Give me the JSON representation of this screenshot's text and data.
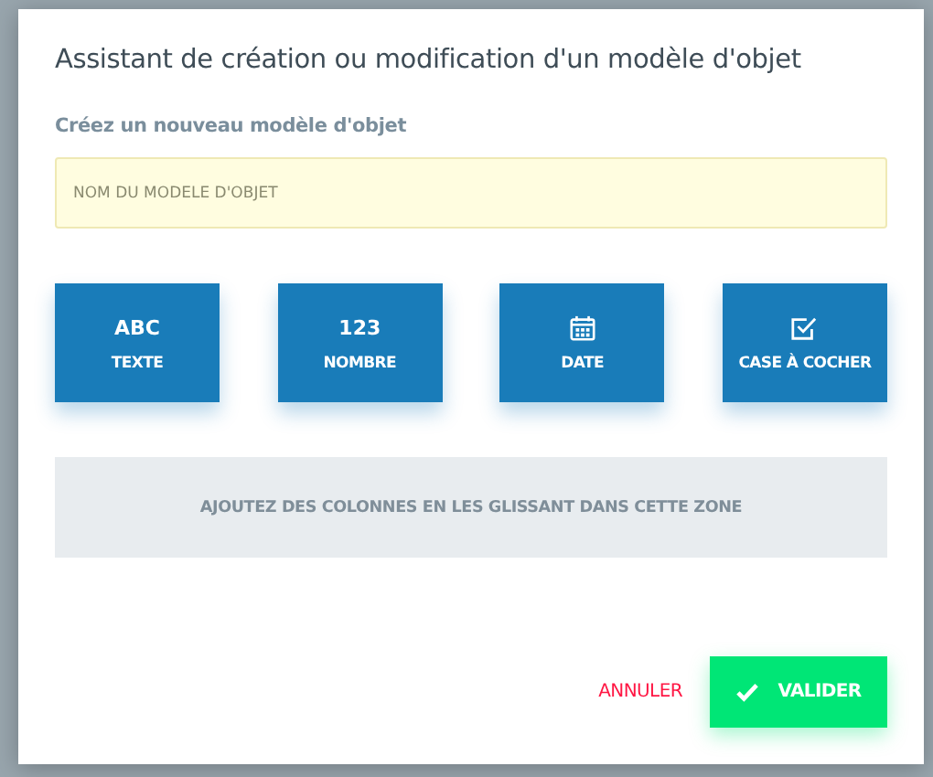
{
  "dialog": {
    "title": "Assistant de création ou modification d'un modèle d'objet",
    "subtitle": "Créez un nouveau modèle d'objet",
    "name_field": {
      "placeholder": "NOM DU MODELE D'OBJET"
    },
    "field_types": [
      {
        "kind": "text",
        "glyph": "ABC",
        "label": "TEXTE"
      },
      {
        "kind": "number",
        "glyph": "123",
        "label": "NOMBRE"
      },
      {
        "kind": "date",
        "label": "DATE"
      },
      {
        "kind": "checkbox",
        "label": "CASE À COCHER"
      }
    ],
    "drop_zone": "AJOUTEZ DES COLONNES EN LES GLISSANT DANS CETTE ZONE",
    "cancel_button": "ANNULER",
    "confirm_button": "VALIDER"
  }
}
